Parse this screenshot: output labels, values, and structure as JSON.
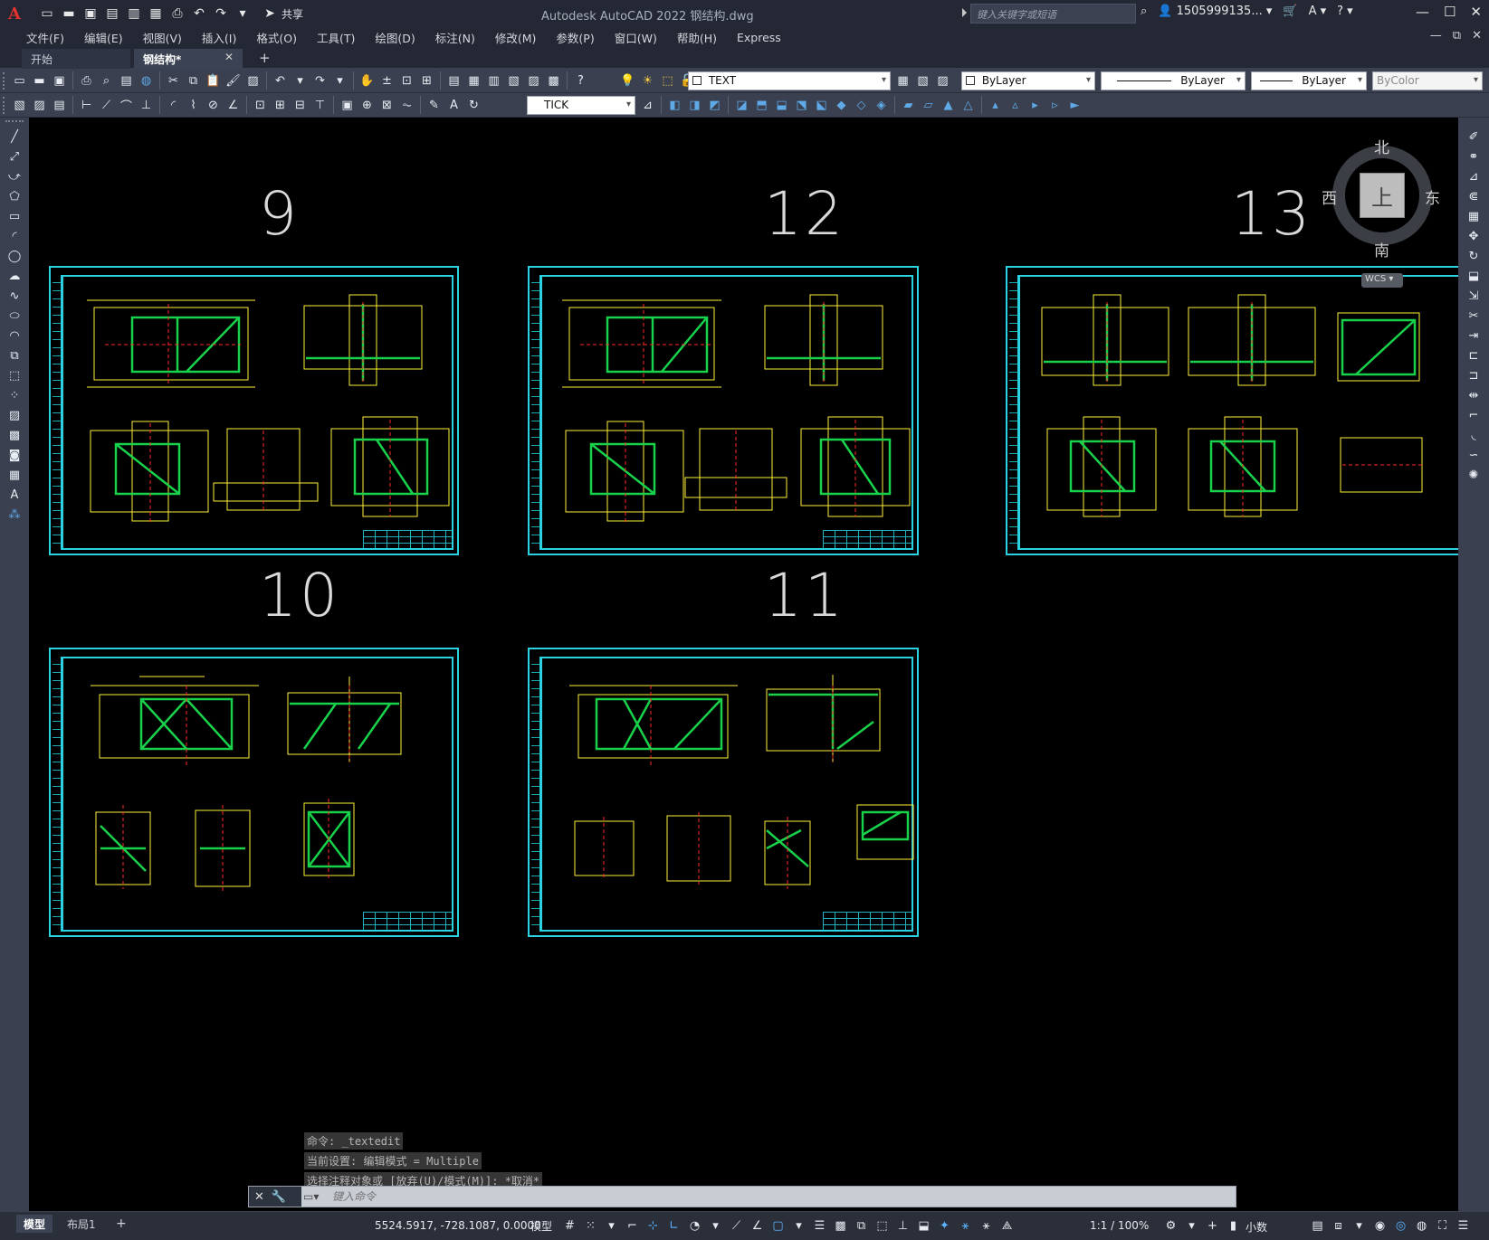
{
  "app": {
    "title": "Autodesk AutoCAD 2022    钢结构.dwg",
    "logo": "A",
    "share_label": "共享",
    "search_placeholder": "键入关键字或短语",
    "user": "1505999135...",
    "window_controls": [
      "minimize-icon",
      "restore-icon",
      "close-icon"
    ]
  },
  "menu": {
    "items": [
      "文件(F)",
      "编辑(E)",
      "视图(V)",
      "插入(I)",
      "格式(O)",
      "工具(T)",
      "绘图(D)",
      "标注(N)",
      "修改(M)",
      "参数(P)",
      "窗口(W)",
      "帮助(H)",
      "Express"
    ]
  },
  "tabs": {
    "start": "开始",
    "doc": "钢结构*",
    "close": "✕",
    "add": "+"
  },
  "toolbar1": {
    "layer_name": "TEXT",
    "color": "ByLayer",
    "linetype": "ByLayer",
    "lineweight": "ByLayer",
    "plotstyle": "ByColor"
  },
  "toolbar2": {
    "dimstyle": "TICK"
  },
  "canvas": {
    "sheets": [
      {
        "number": "9"
      },
      {
        "number": "12"
      },
      {
        "number": "13"
      },
      {
        "number": "10"
      },
      {
        "number": "11"
      }
    ],
    "viewcube": {
      "north": "北",
      "south": "南",
      "east": "东",
      "west": "西",
      "face": "上",
      "wcs": "WCS"
    }
  },
  "command": {
    "history": [
      "命令: _textedit",
      "当前设置: 编辑模式 = Multiple",
      "选择注释对象或 [放弃(U)/模式(M)]: *取消*"
    ],
    "placeholder": "键入命令"
  },
  "status": {
    "model_tab": "模型",
    "layout_tab": "布局1",
    "add_tab": "+",
    "coordinates": "5524.5917, -728.1087, 0.0000",
    "space": "模型",
    "scale": "1:1 / 100%",
    "units": "小数"
  },
  "colors": {
    "canvas": "#000000",
    "sheet_border": "#2ad1e0",
    "drawing_yellow": "#ffef3a",
    "drawing_green": "#19d24b",
    "drawing_red": "#ff2a2a",
    "accent_blue": "#5cb3ff"
  }
}
